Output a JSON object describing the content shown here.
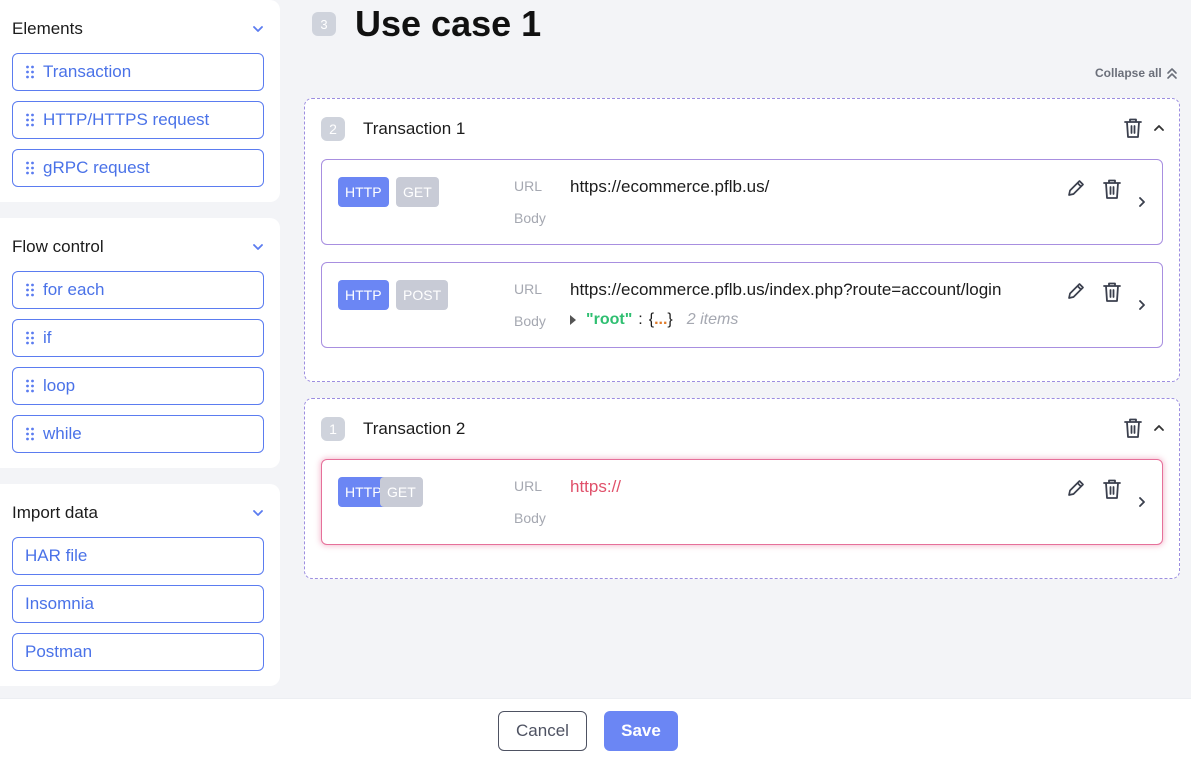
{
  "sidebar": {
    "elements": {
      "title": "Elements",
      "items": [
        "Transaction",
        "HTTP/HTTPS request",
        "gRPC request"
      ]
    },
    "flow_control": {
      "title": "Flow control",
      "items": [
        "for each",
        "if",
        "loop",
        "while"
      ]
    },
    "import_data": {
      "title": "Import data",
      "items": [
        "HAR file",
        "Insomnia",
        "Postman"
      ]
    }
  },
  "use_case": {
    "number": "3",
    "title": "Use case 1"
  },
  "collapse_all_label": "Collapse all",
  "transactions": [
    {
      "number": "2",
      "name": "Transaction 1",
      "requests": [
        {
          "protocol": "HTTP",
          "method": "GET",
          "url_label": "URL",
          "url": "https://ecommerce.pflb.us/",
          "body_label": "Body"
        },
        {
          "protocol": "HTTP",
          "method": "POST",
          "url_label": "URL",
          "url": "https://ecommerce.pflb.us/index.php?route=account/login",
          "body_label": "Body",
          "body_key": "\"root\"",
          "body_colon": ":",
          "body_open": "{",
          "body_dots": "...",
          "body_close": "}",
          "body_count": "2 items"
        }
      ]
    },
    {
      "number": "1",
      "name": "Transaction 2",
      "requests": [
        {
          "protocol": "HTTP",
          "method": "GET",
          "url_label": "URL",
          "url": "https://",
          "body_label": "Body"
        }
      ]
    }
  ],
  "footer": {
    "cancel_label": "Cancel",
    "save_label": "Save"
  },
  "colors": {
    "accent": "#6b86f4",
    "link": "#4a72e8",
    "error": "#e0506a",
    "json_key": "#2fbf71"
  }
}
